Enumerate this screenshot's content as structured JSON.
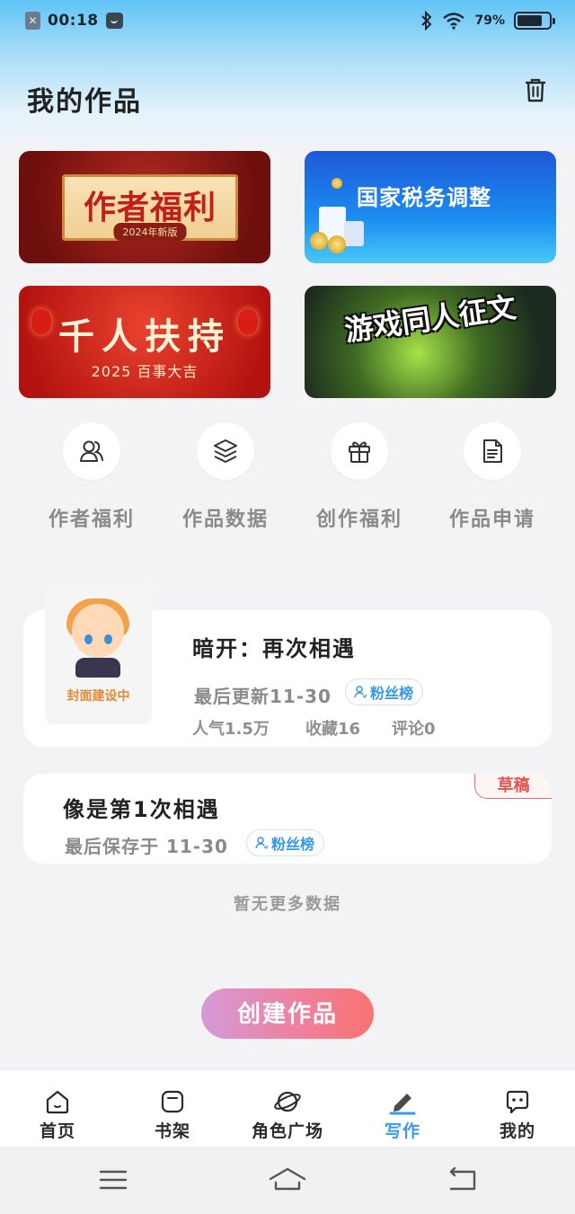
{
  "status_bar": {
    "time": "00:18",
    "battery_text": "79%",
    "battery_level": 0.79,
    "icons": [
      "app-notification-icon",
      "message-icon",
      "bluetooth-icon",
      "wifi-icon",
      "battery-icon"
    ]
  },
  "header": {
    "title": "我的作品",
    "trash_icon": "trash-icon"
  },
  "banners": [
    {
      "title": "作者福利",
      "subtitle": "2024年新版"
    },
    {
      "title": "国家税务调整"
    },
    {
      "title": "千人扶持",
      "subtitle": "2025 百事大吉"
    },
    {
      "title": "游戏同人征文"
    }
  ],
  "actions": [
    {
      "label": "作者福利",
      "icon": "users-icon"
    },
    {
      "label": "作品数据",
      "icon": "layers-icon"
    },
    {
      "label": "创作福利",
      "icon": "gift-icon"
    },
    {
      "label": "作品申请",
      "icon": "document-icon"
    }
  ],
  "works": [
    {
      "title": "暗开：再次相遇",
      "cover_label": "封面建设中",
      "updated": "最后更新11-30",
      "fans_badge": "粉丝榜",
      "popularity": "人气1.5万",
      "favorites": "收藏16",
      "comments": "评论0"
    }
  ],
  "drafts": [
    {
      "tag": "草稿",
      "title": "像是第1次相遇",
      "saved": "最后保存于 11-30",
      "fans_badge": "粉丝榜"
    }
  ],
  "no_more_text": "暂无更多数据",
  "create_button": "创建作品",
  "tabbar": {
    "active": "写作",
    "items": [
      {
        "label": "首页",
        "icon": "home-icon"
      },
      {
        "label": "书架",
        "icon": "bookshelf-icon"
      },
      {
        "label": "角色广场",
        "icon": "planet-icon"
      },
      {
        "label": "写作",
        "icon": "pen-icon"
      },
      {
        "label": "我的",
        "icon": "chat-icon"
      }
    ]
  },
  "colors": {
    "accent_blue": "#3c9ae8",
    "draft_red": "#e4534f",
    "create_gradient_start": "#d49ad6",
    "create_gradient_end": "#f7736f"
  }
}
